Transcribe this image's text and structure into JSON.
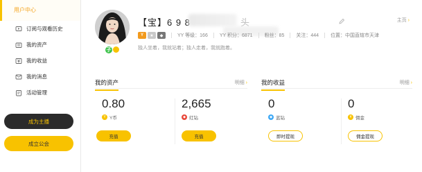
{
  "sidebar": {
    "title": "用户中心",
    "items": [
      {
        "label": "订阅与观看历史",
        "icon": "subscription-history-icon"
      },
      {
        "label": "我的资产",
        "icon": "assets-icon"
      },
      {
        "label": "我的收益",
        "icon": "income-icon"
      },
      {
        "label": "我的消息",
        "icon": "message-icon"
      },
      {
        "label": "活动管理",
        "icon": "activity-icon"
      }
    ],
    "become_anchor": "成为主播",
    "create_guild": "成立公会"
  },
  "profile": {
    "name": "【宝】6 9 8",
    "name_tail": "头",
    "home_link": "主页",
    "home_arrow": "›",
    "level": "YY 等级：166",
    "points": "YY 积分：6871",
    "fans": "粉丝：85",
    "follow": "关注：444",
    "location": "位置：中国直辖市天津",
    "bio": "独人坐着，我就站着；独人走着，我就跑着。",
    "badge_text": "子"
  },
  "assets": {
    "title": "我的资产",
    "more": "明细",
    "more_arrow": "›",
    "ycoin": {
      "value": "0.80",
      "label": "Y币",
      "button": "充值"
    },
    "redgem": {
      "value": "2,665",
      "label": "红钻",
      "button": "充值"
    }
  },
  "income": {
    "title": "我的收益",
    "more": "明细",
    "more_arrow": "›",
    "bluegem": {
      "value": "0",
      "label": "蓝钻",
      "button": "即时提现"
    },
    "commission": {
      "value": "0",
      "label": "佣金",
      "button": "佣金提现"
    }
  },
  "colors": {
    "accent": "#f8c200",
    "dark": "#2b2b2b",
    "red": "#e8483a",
    "blue": "#3fa9f5"
  }
}
